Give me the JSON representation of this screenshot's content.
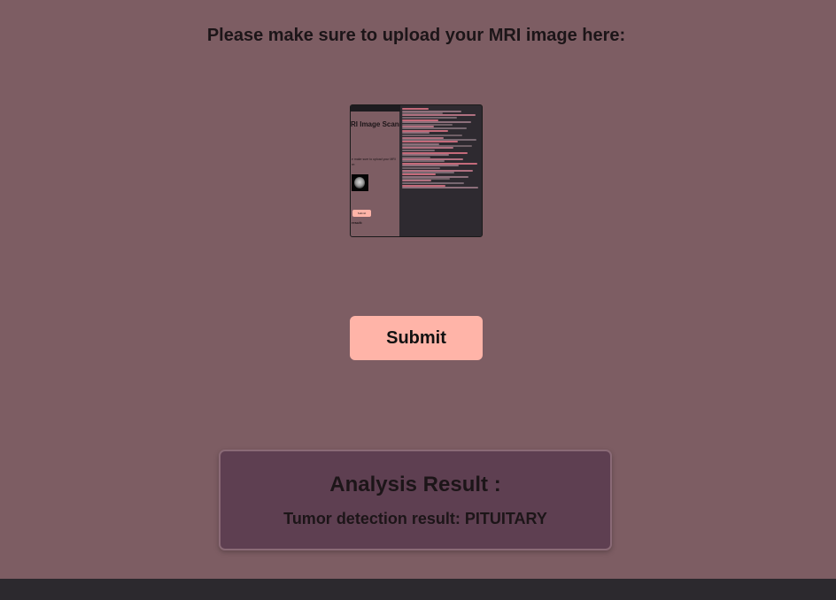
{
  "upload": {
    "heading": "Please make sure to upload your MRI image here:"
  },
  "thumbnail": {
    "title_line": "RI Image Scanner",
    "upload_text": "e make sure to upload your MRI",
    "upload_text_2": "re:",
    "submit_label": "Submit",
    "result_label": "result:"
  },
  "form": {
    "submit_label": "Submit"
  },
  "result": {
    "title": "Analysis Result :",
    "text": "Tumor detection result: PITUITARY"
  },
  "colors": {
    "background": "#7d5d63",
    "accent": "#ffb4a8",
    "card": "#5e3f51",
    "footer": "#2c292e"
  }
}
